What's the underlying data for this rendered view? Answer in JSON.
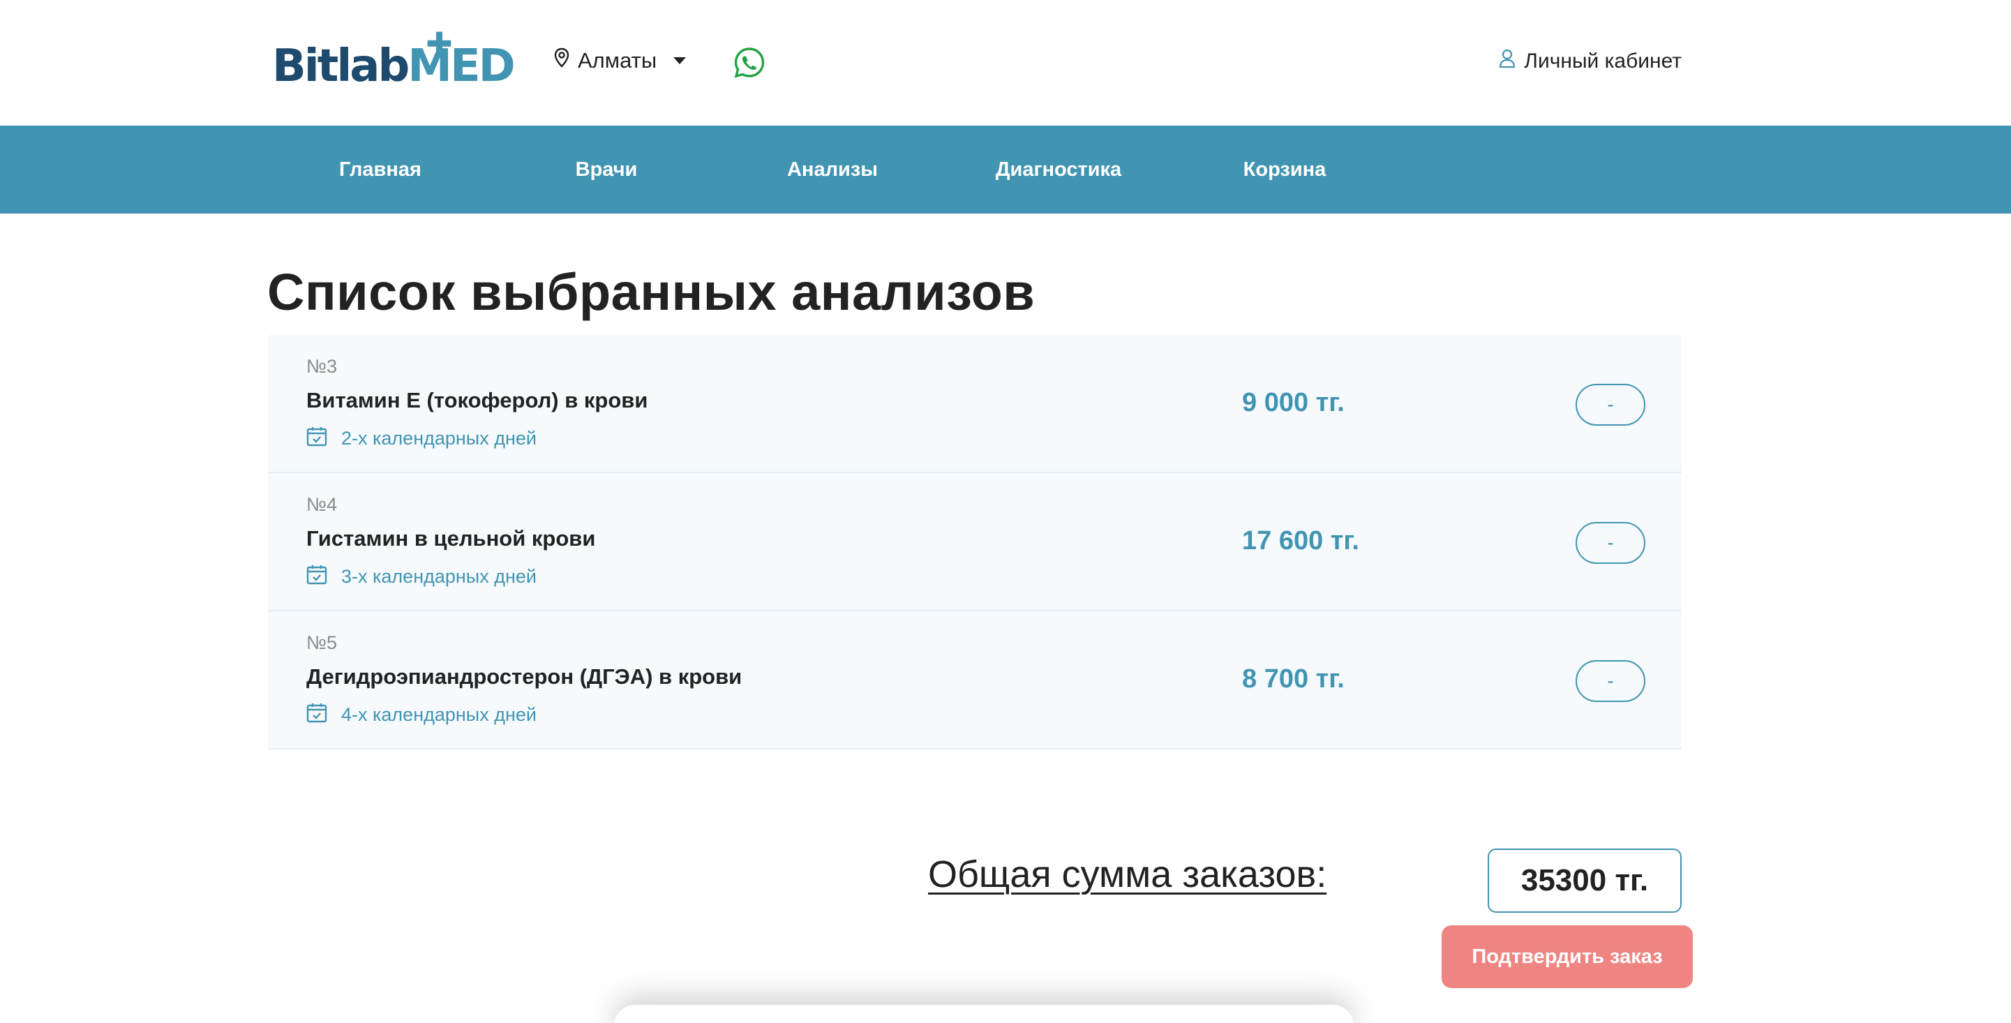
{
  "header": {
    "logo_main": "Bitlab",
    "logo_accent": "MED",
    "city": "Алматы",
    "account_label": "Личный кабинет"
  },
  "nav": {
    "items": [
      {
        "label": "Главная"
      },
      {
        "label": "Врачи"
      },
      {
        "label": "Анализы"
      },
      {
        "label": "Диагностика"
      },
      {
        "label": "Корзина"
      }
    ]
  },
  "page": {
    "title": "Список выбранных анализов"
  },
  "tests": [
    {
      "number": "№3",
      "name": "Витамин Е (токоферол) в крови",
      "days": "2-х календарных дней",
      "price": "9 000 тг.",
      "remove_label": "-"
    },
    {
      "number": "№4",
      "name": "Гистамин в цельной крови",
      "days": "3-х календарных дней",
      "price": "17 600 тг.",
      "remove_label": "-"
    },
    {
      "number": "№5",
      "name": "Дегидроэпиандростерон (ДГЭА) в крови",
      "days": "4-х календарных дней",
      "price": "8 700 тг.",
      "remove_label": "-"
    }
  ],
  "summary": {
    "total_label": "Общая сумма заказов:",
    "total_value": "35300 тг.",
    "confirm_label": "Подтвердить заказ"
  },
  "colors": {
    "brand_dark": "#1e4a6d",
    "brand_accent": "#4194b2",
    "confirm_button": "#ef8582",
    "whatsapp": "#25a244"
  },
  "icons": {
    "city": "map-pin-icon",
    "whatsapp": "whatsapp-icon",
    "account": "user-icon",
    "days": "calendar-check-icon"
  }
}
